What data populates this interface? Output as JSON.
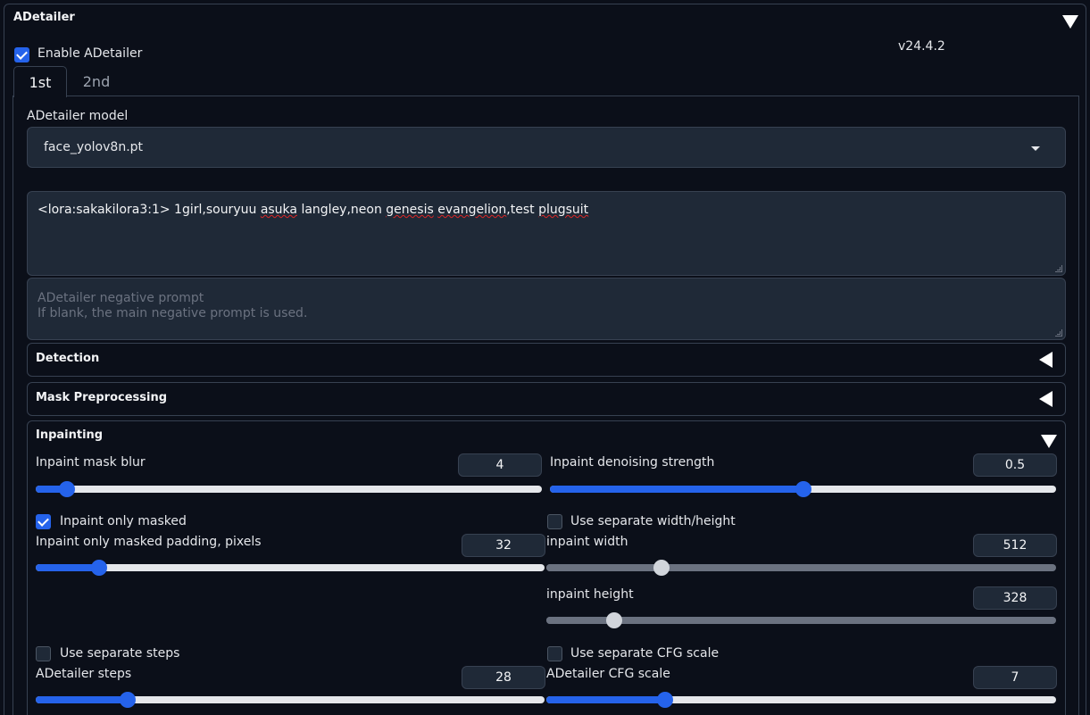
{
  "panel": {
    "title": "ADetailer",
    "version": "v24.4.2",
    "enable_label": "Enable ADetailer",
    "enable_checked": true
  },
  "tabs": [
    {
      "label": "1st",
      "active": true
    },
    {
      "label": "2nd",
      "active": false
    }
  ],
  "model": {
    "label": "ADetailer model",
    "value": "face_yolov8n.pt"
  },
  "prompt": {
    "pre": "<lora:sakakilora3:1> 1girl,souryuu ",
    "w1": "asuka",
    "mid1": " langley,neon ",
    "w2": "genesis",
    "mid2": " ",
    "w3": "evangelion",
    "mid3": ",test ",
    "w4": "plugsuit"
  },
  "negative_prompt": {
    "placeholder_line1": "ADetailer negative prompt",
    "placeholder_line2": "If blank, the main negative prompt is used."
  },
  "sections": {
    "detection": "Detection",
    "mask": "Mask Preprocessing",
    "inpainting": "Inpainting"
  },
  "inpainting": {
    "mask_blur": {
      "label": "Inpaint mask blur",
      "value": "4",
      "min": 0,
      "max": 64,
      "num": 4
    },
    "denoise": {
      "label": "Inpaint denoising strength",
      "value": "0.5",
      "min": 0,
      "max": 1,
      "num": 0.5
    },
    "only_masked": {
      "label": "Inpaint only masked",
      "checked": true
    },
    "padding": {
      "label": "Inpaint only masked padding, pixels",
      "value": "32",
      "min": 0,
      "max": 256,
      "num": 32
    },
    "sep_wh": {
      "label": "Use separate width/height",
      "checked": false
    },
    "width": {
      "label": "inpaint width",
      "value": "512",
      "min": 64,
      "max": 2048,
      "num": 512
    },
    "height": {
      "label": "inpaint height",
      "value": "328",
      "min": 64,
      "max": 2048,
      "num": 328
    },
    "sep_steps": {
      "label": "Use separate steps",
      "checked": false
    },
    "steps": {
      "label": "ADetailer steps",
      "value": "28",
      "min": 1,
      "max": 150,
      "num": 28
    },
    "sep_cfg": {
      "label": "Use separate CFG scale",
      "checked": false
    },
    "cfg": {
      "label": "ADetailer CFG scale",
      "value": "7",
      "min": 0,
      "max": 30,
      "num": 7
    }
  },
  "colors": {
    "accent": "#2563eb",
    "track": "#e5e7eb",
    "track_disabled": "#6b7280",
    "thumb_disabled": "#d1d5db"
  }
}
